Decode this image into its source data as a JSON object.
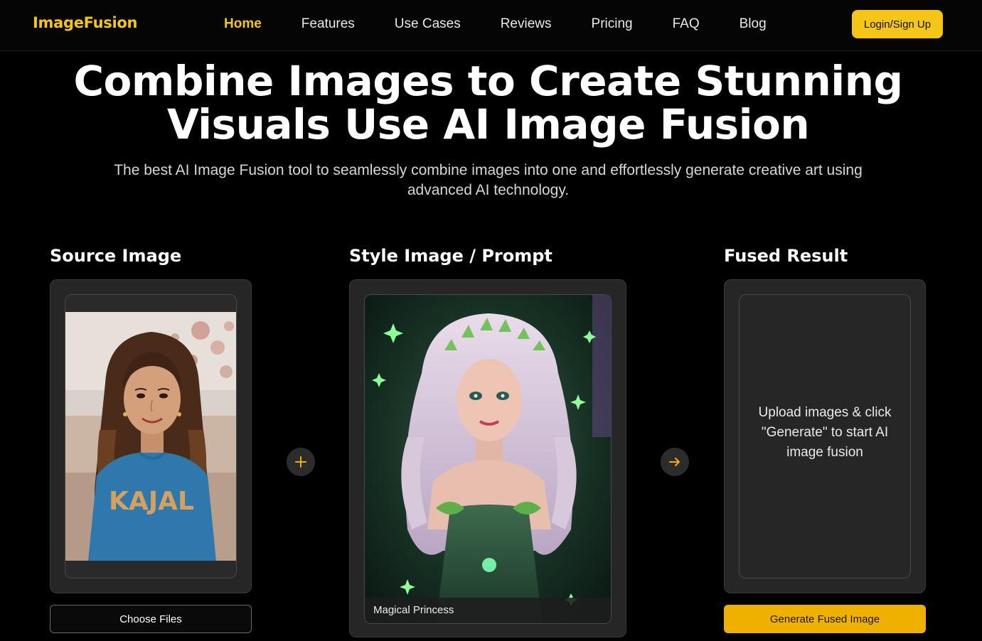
{
  "nav": {
    "logo": "ImageFusion",
    "links": [
      {
        "label": "Home",
        "active": true
      },
      {
        "label": "Features"
      },
      {
        "label": "Use Cases"
      },
      {
        "label": "Reviews"
      },
      {
        "label": "Pricing"
      },
      {
        "label": "FAQ"
      },
      {
        "label": "Blog"
      }
    ],
    "login_label": "Login/Sign Up"
  },
  "hero": {
    "title_line1": "Combine Images to Create Stunning",
    "title_line2": "Visuals Use AI Image Fusion",
    "subtitle": "The best AI Image Fusion tool to seamlessly combine images into one and effortlessly generate creative art using advanced AI technology."
  },
  "source": {
    "title": "Source Image",
    "choose_label": "Choose Files",
    "shirt_text": "KAJAL"
  },
  "style": {
    "title": "Style Image / Prompt",
    "caption": "Magical Princess"
  },
  "result": {
    "title": "Fused Result",
    "placeholder": "Upload images & click \"Generate\" to start AI image fusion",
    "generate_label": "Generate Fused Image"
  },
  "icons": {
    "plus": "plus-icon",
    "arrow": "arrow-right-icon"
  },
  "colors": {
    "accent": "#f5c518",
    "generate": "#f0b000",
    "background": "#000000",
    "panel": "#262626"
  }
}
